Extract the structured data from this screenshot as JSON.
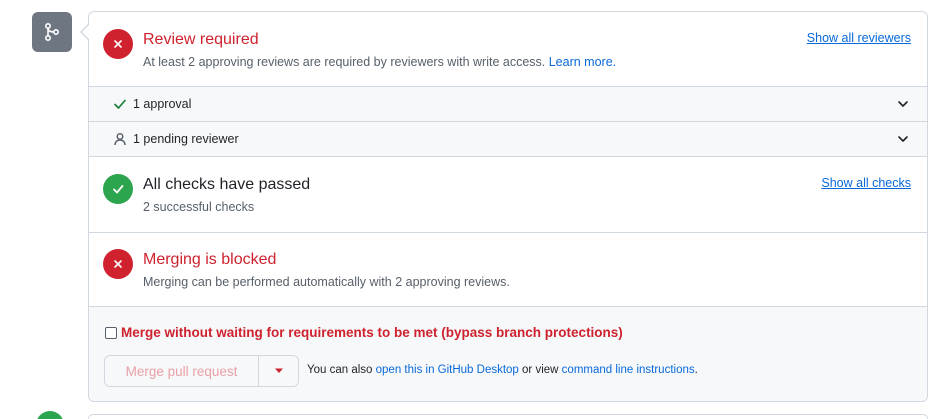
{
  "review": {
    "title": "Review required",
    "desc_prefix": "At least 2 approving reviews are required by reviewers with write access. ",
    "learn_more": "Learn more.",
    "show_all": "Show all reviewers"
  },
  "approvals": {
    "label": "1 approval"
  },
  "pending": {
    "label": "1 pending reviewer"
  },
  "checks": {
    "title": "All checks have passed",
    "desc": "2 successful checks",
    "show_all": "Show all checks"
  },
  "blocked": {
    "title": "Merging is blocked",
    "desc": "Merging can be performed automatically with 2 approving reviews."
  },
  "merge": {
    "bypass_label": "Merge without waiting for requirements to be met (bypass branch protections)",
    "button_label": "Merge pull request",
    "note_prefix": "You can also ",
    "desktop_link": "open this in GitHub Desktop",
    "note_middle": " or view ",
    "cli_link": "command line instructions",
    "note_suffix": "."
  },
  "colors": {
    "danger": "#cf222e",
    "success": "#2da44e",
    "link": "#0969da",
    "badge": "#6e7781"
  }
}
